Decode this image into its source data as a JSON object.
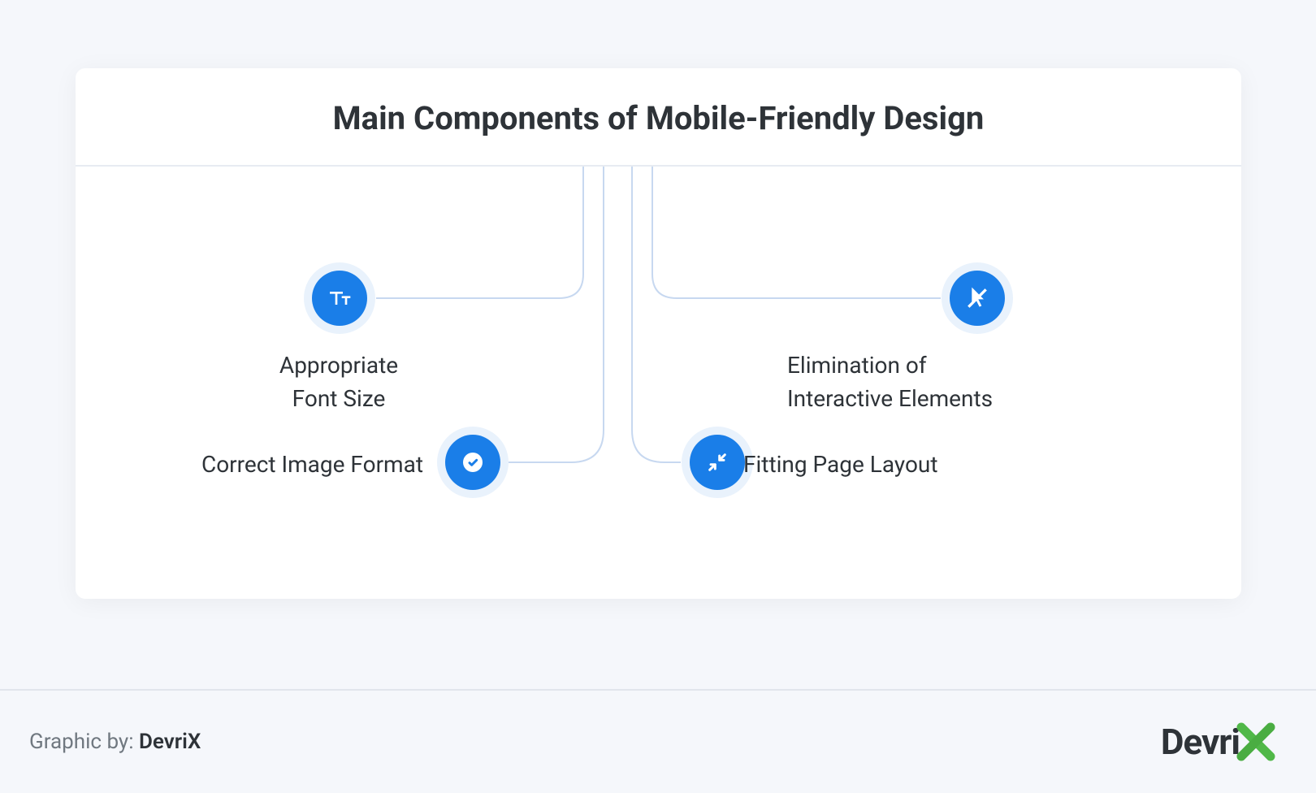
{
  "title": "Main Components of Mobile-Friendly Design",
  "nodes": {
    "top_left": {
      "line1": "Appropriate",
      "line2": "Font Size"
    },
    "top_right": {
      "line1": "Elimination of",
      "line2": "Interactive Elements"
    },
    "bottom_left": {
      "text": "Correct Image Format"
    },
    "bottom_right": {
      "text": "Fitting Page Layout"
    }
  },
  "footer": {
    "prefix": "Graphic by: ",
    "brand": "DevriX"
  },
  "logo": {
    "text": "Devri"
  },
  "colors": {
    "accent": "#1a7ee8",
    "connector": "#c7d8f0",
    "x_green": "#50b848"
  }
}
